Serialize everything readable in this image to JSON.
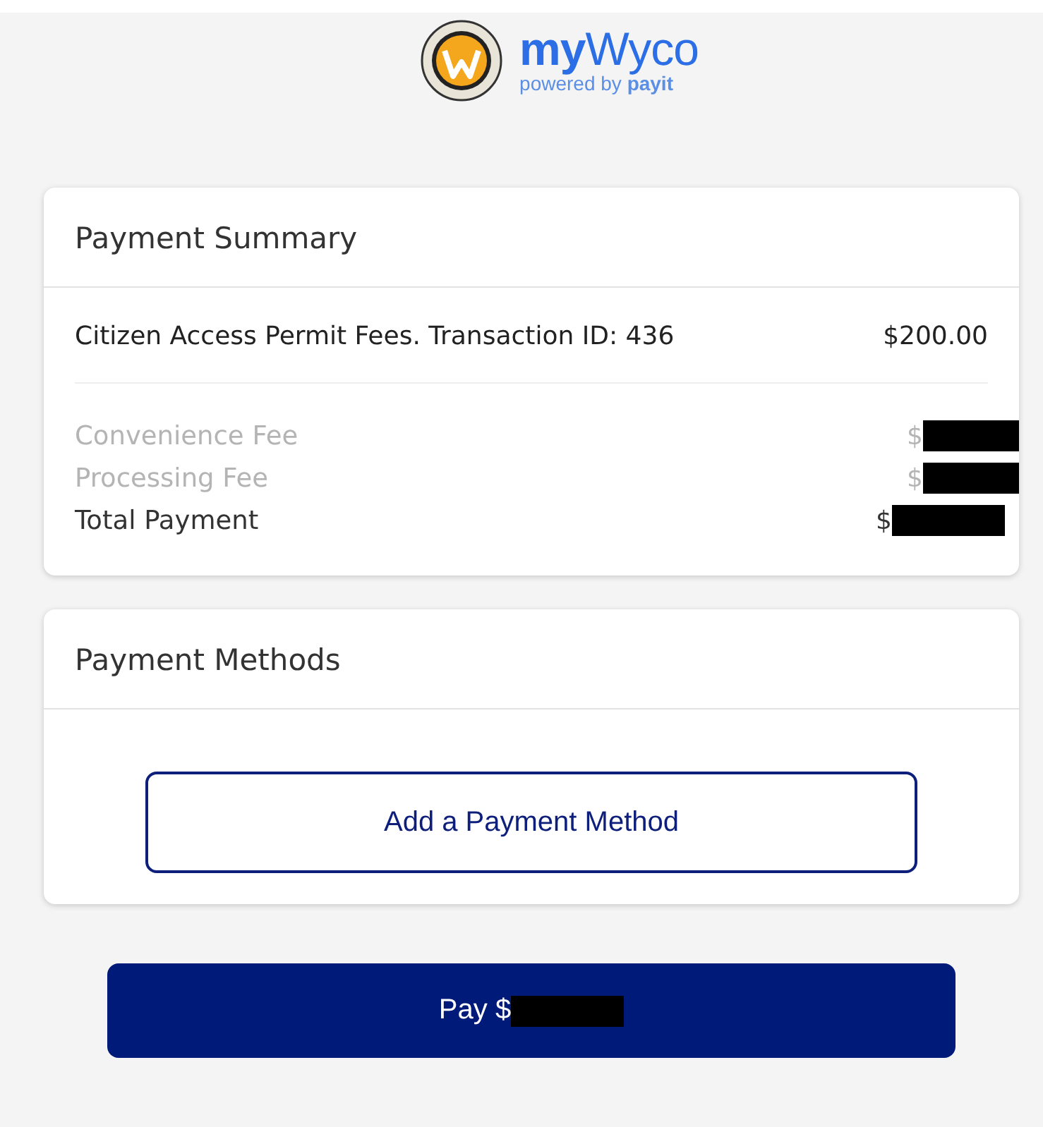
{
  "header": {
    "brand": "**my**Wyco",
    "tagline": "powered by **payit**"
  },
  "summary": {
    "title": "Payment Summary",
    "item": {
      "label": "Citizen Access Permit Fees. Transaction ID: 436",
      "amount": "$200.00"
    },
    "fees": [
      {
        "kind": "fee",
        "label": "Convenience Fee",
        "amount": "$",
        "redacted": true
      },
      {
        "kind": "fee",
        "label": "Processing Fee",
        "amount": "$",
        "redacted": true
      },
      {
        "kind": "total",
        "label": "Total Payment",
        "amount": "$",
        "redacted": true
      }
    ]
  },
  "methods": {
    "title": "Payment Methods",
    "add_button": "Add a Payment Method"
  },
  "pay_button": {
    "label": "Pay $",
    "redacted": true
  }
}
